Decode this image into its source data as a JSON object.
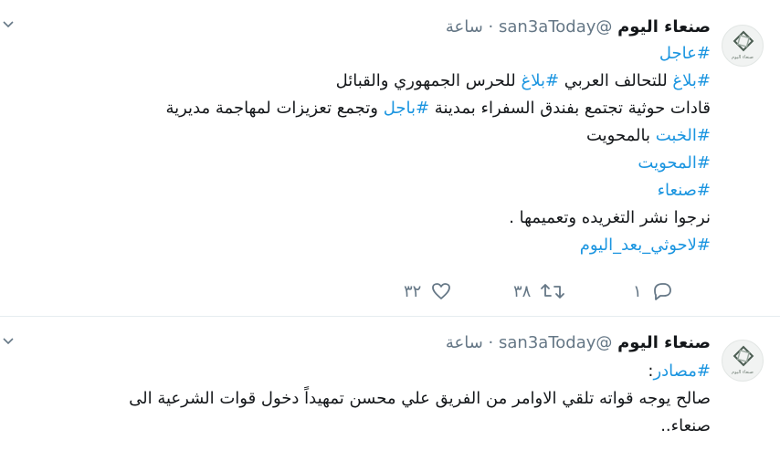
{
  "tweets": [
    {
      "name": "صنعاء اليوم",
      "handle": "@san3aToday",
      "separator": "·",
      "time": "ساعة",
      "avatar_text": "صنعاء اليوم",
      "lines": [
        [
          {
            "t": "#عاجل",
            "h": true
          }
        ],
        [
          {
            "t": "#بلاغ",
            "h": true
          },
          {
            "t": " للتحالف العربي ",
            "h": false
          },
          {
            "t": "#بلاغ",
            "h": true
          },
          {
            "t": " للحرس الجمهوري والقبائل",
            "h": false
          }
        ],
        [
          {
            "t": "قادات حوثية تجتمع بفندق السفراء بمدينة ",
            "h": false
          },
          {
            "t": "#باجل",
            "h": true
          },
          {
            "t": " وتجمع تعزيزات لمهاجمة مديرية",
            "h": false
          }
        ],
        [
          {
            "t": "#الخبت",
            "h": true
          },
          {
            "t": " بالمحويت",
            "h": false
          }
        ],
        [
          {
            "t": "#المحويت",
            "h": true
          }
        ],
        [
          {
            "t": "#صنعاء",
            "h": true
          }
        ],
        [
          {
            "t": "نرجوا نشر التغريده وتعميمها .",
            "h": false
          }
        ],
        [
          {
            "t": "#لاحوثي_بعد_اليوم",
            "h": true
          }
        ]
      ],
      "actions": {
        "reply": "١",
        "retweet": "٣٨",
        "like": "٣٢"
      }
    },
    {
      "name": "صنعاء اليوم",
      "handle": "@san3aToday",
      "separator": "·",
      "time": "ساعة",
      "avatar_text": "صنعاء اليوم",
      "lines": [
        [
          {
            "t": "#مصادر",
            "h": true
          },
          {
            "t": ":",
            "h": false
          }
        ],
        [
          {
            "t": " صالح يوجه قواته تلقي الاوامر من الفريق علي محسن تمهيداً دخول قوات الشرعية الى",
            "h": false
          }
        ],
        [
          {
            "t": "صنعاء..",
            "h": false
          }
        ]
      ]
    }
  ],
  "colors": {
    "link": "#1b95e0",
    "muted": "#657786",
    "text": "#14171a",
    "divider": "#e6ecf0"
  },
  "icons": [
    "chevron-down-icon",
    "reply-icon",
    "retweet-icon",
    "like-icon",
    "avatar-logo-icon"
  ]
}
